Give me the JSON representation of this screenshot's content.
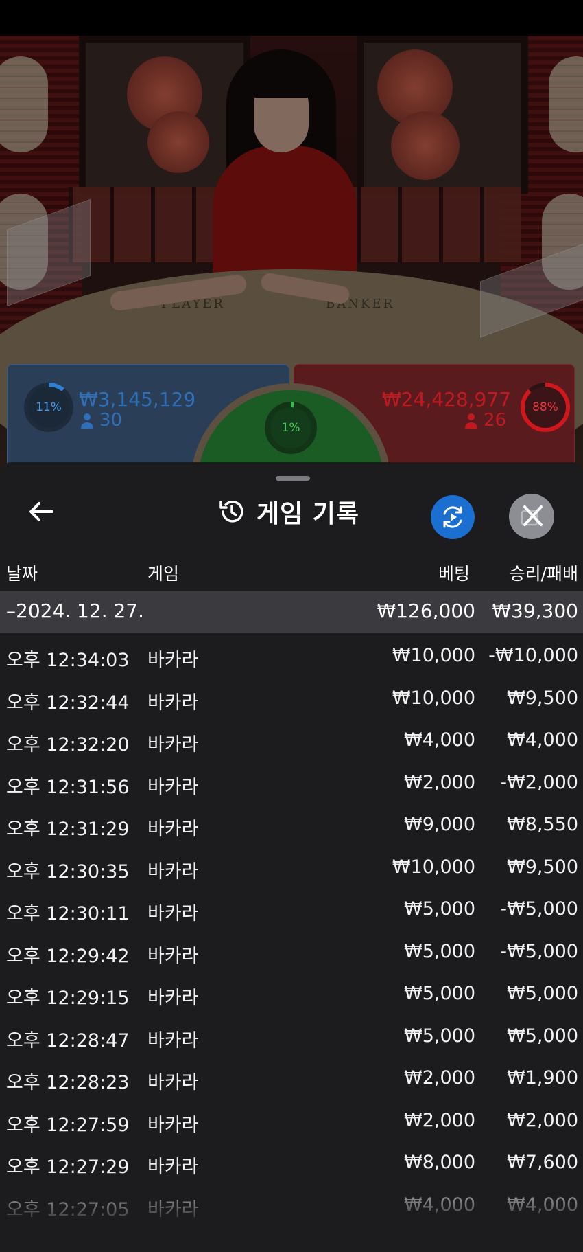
{
  "video": {
    "table_labels": [
      "PLAYER",
      "BANKER"
    ]
  },
  "bets": {
    "player": {
      "percent": "11%",
      "amount": "₩3,145,129",
      "players": "30",
      "percent_value": 11,
      "color": "#2f7fd6"
    },
    "banker": {
      "percent": "88%",
      "amount": "₩24,428,977",
      "players": "26",
      "percent_value": 88,
      "color": "#d1161c"
    },
    "tie": {
      "percent": "1%",
      "percent_value": 1,
      "color": "#36b84a"
    }
  },
  "history": {
    "title": "게임 기록",
    "columns": {
      "date": "날짜",
      "game": "게임",
      "bet": "베팅",
      "result": "승리/패배"
    },
    "day": {
      "label": "–2024. 12. 27.",
      "bet_total": "₩126,000",
      "result_total": "₩39,300"
    },
    "rows": [
      {
        "time": "오후 12:34:03",
        "game": "바카라",
        "bet": "₩10,000",
        "result": "-₩10,000"
      },
      {
        "time": "오후 12:32:44",
        "game": "바카라",
        "bet": "₩10,000",
        "result": "₩9,500"
      },
      {
        "time": "오후 12:32:20",
        "game": "바카라",
        "bet": "₩4,000",
        "result": "₩4,000"
      },
      {
        "time": "오후 12:31:56",
        "game": "바카라",
        "bet": "₩2,000",
        "result": "-₩2,000"
      },
      {
        "time": "오후 12:31:29",
        "game": "바카라",
        "bet": "₩9,000",
        "result": "₩8,550"
      },
      {
        "time": "오후 12:30:35",
        "game": "바카라",
        "bet": "₩10,000",
        "result": "₩9,500"
      },
      {
        "time": "오후 12:30:11",
        "game": "바카라",
        "bet": "₩5,000",
        "result": "-₩5,000"
      },
      {
        "time": "오후 12:29:42",
        "game": "바카라",
        "bet": "₩5,000",
        "result": "-₩5,000"
      },
      {
        "time": "오후 12:29:15",
        "game": "바카라",
        "bet": "₩5,000",
        "result": "₩5,000"
      },
      {
        "time": "오후 12:28:47",
        "game": "바카라",
        "bet": "₩5,000",
        "result": "₩5,000"
      },
      {
        "time": "오후 12:28:23",
        "game": "바카라",
        "bet": "₩2,000",
        "result": "₩1,900"
      },
      {
        "time": "오후 12:27:59",
        "game": "바카라",
        "bet": "₩2,000",
        "result": "₩2,000"
      },
      {
        "time": "오후 12:27:29",
        "game": "바카라",
        "bet": "₩8,000",
        "result": "₩7,600"
      },
      {
        "time": "오후 12:27:05",
        "game": "바카라",
        "bet": "₩4,000",
        "result": "₩4,000"
      }
    ]
  },
  "icons": {
    "back": "arrow-left-icon",
    "history": "history-clock-icon",
    "replay": "replay-play-icon",
    "close": "close-icon"
  }
}
